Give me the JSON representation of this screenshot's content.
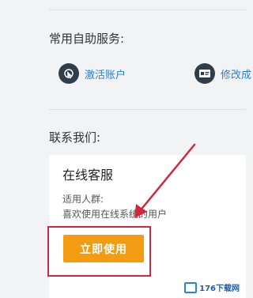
{
  "self_service": {
    "title": "常用自助服务:",
    "items": [
      {
        "label": "激活账户",
        "icon": "cursor-click-icon"
      },
      {
        "label": "修改成",
        "icon": "id-card-icon"
      }
    ]
  },
  "contact": {
    "title": "联系我们:",
    "card": {
      "title": "在线客服",
      "audience_label": "适用人群:",
      "audience_value": "喜欢使用在线系统的用户",
      "button_label": "立即使用"
    }
  },
  "watermark": {
    "text": "176下载网"
  },
  "colors": {
    "button_bg": "#f39c12",
    "link_color": "#2a7fd4",
    "highlight_red": "#d1263d",
    "icon_bg": "#2f3e4a"
  }
}
